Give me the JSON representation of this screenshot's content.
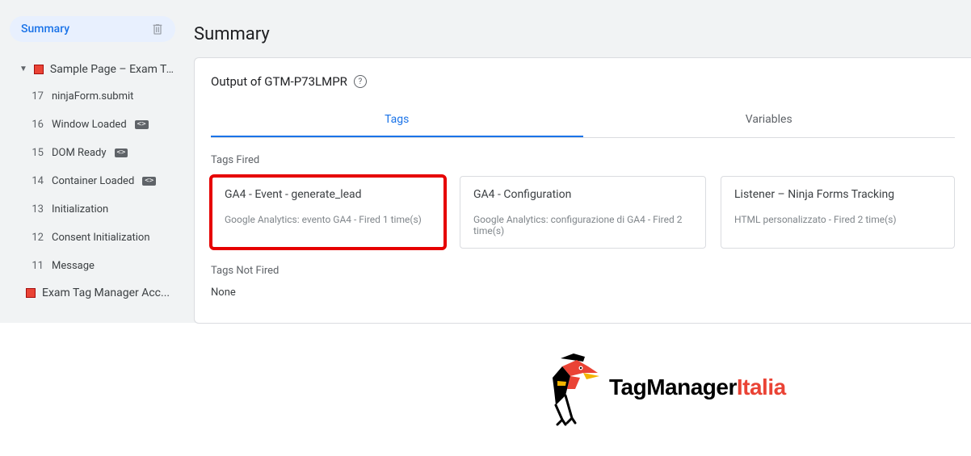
{
  "sidebar": {
    "summary_label": "Summary",
    "page_title": "Sample Page – Exam Ta...",
    "events": [
      {
        "idx": "17",
        "label": "ninjaForm.submit",
        "chip": null
      },
      {
        "idx": "16",
        "label": "Window Loaded",
        "chip": "<>"
      },
      {
        "idx": "15",
        "label": "DOM Ready",
        "chip": "<>"
      },
      {
        "idx": "14",
        "label": "Container Loaded",
        "chip": "<>"
      },
      {
        "idx": "13",
        "label": "Initialization",
        "chip": null
      },
      {
        "idx": "12",
        "label": "Consent Initialization",
        "chip": null
      },
      {
        "idx": "11",
        "label": "Message",
        "chip": null
      }
    ],
    "page_title_2": "Exam Tag Manager Acc..."
  },
  "main": {
    "title": "Summary",
    "output_label": "Output of GTM-P73LMPR",
    "tabs": {
      "tags": "Tags",
      "vars": "Variables"
    },
    "fired_label": "Tags Fired",
    "not_fired_label": "Tags Not Fired",
    "none": "None",
    "cards": [
      {
        "title": "GA4 - Event - generate_lead",
        "sub": "Google Analytics: evento GA4 - Fired 1 time(s)"
      },
      {
        "title": "GA4 - Configuration",
        "sub": "Google Analytics: configurazione di GA4 - Fired 2 time(s)"
      },
      {
        "title": "Listener – Ninja Forms Tracking",
        "sub": "HTML personalizzato - Fired 2 time(s)"
      }
    ]
  },
  "brand": {
    "a": "TagManager",
    "b": "Italia"
  }
}
